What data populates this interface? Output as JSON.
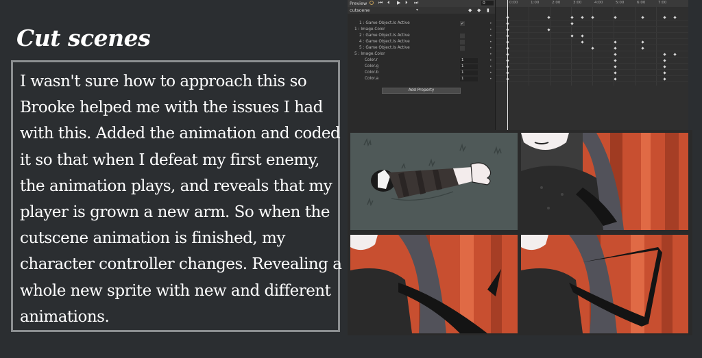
{
  "title": "Cut scenes",
  "description": "I wasn't sure how to approach this so Brooke helped me with the issues I had with this. Added the animation and coded it so that when I defeat my first enemy, the animation plays, and reveals that my player is grown a new arm. So when the cutscene animation is finished, my character controller changes. Revealing a whole new sprite with new and different animations.",
  "animation_window": {
    "preview_label": "Preview",
    "frame_value": "0",
    "clip_name": "cutscene",
    "add_property_label": "Add Property",
    "timeline_ticks": [
      "0:00",
      "1:00",
      "2:00",
      "3:00",
      "4:00",
      "5:00",
      "6:00",
      "7:00"
    ],
    "properties": [
      {
        "label": "1 : Game Object.Is Active",
        "value": "✓"
      },
      {
        "label": "1 : Image.Color",
        "value": ""
      },
      {
        "label": "2 : Game Object.Is Active",
        "value": ""
      },
      {
        "label": "4 : Game Object.Is Active",
        "value": ""
      },
      {
        "label": "5 : Game Object.Is Active",
        "value": ""
      },
      {
        "label": "5 : Image.Color",
        "value": ""
      },
      {
        "label": "Color.r",
        "value": "1"
      },
      {
        "label": "Color.g",
        "value": "1"
      },
      {
        "label": "Color.b",
        "value": "1"
      },
      {
        "label": "Color.a",
        "value": "1"
      }
    ]
  },
  "colors": {
    "background": "#2b2e31",
    "text": "#ffffff",
    "border": "#8c8f91",
    "forest_red": "#c84f30",
    "grass": "#4a5452"
  },
  "icons": [
    "record-icon",
    "first-frame-icon",
    "prev-frame-icon",
    "play-icon",
    "next-frame-icon",
    "last-frame-icon",
    "add-keyframe-icon",
    "add-event-icon",
    "filter-icon"
  ]
}
